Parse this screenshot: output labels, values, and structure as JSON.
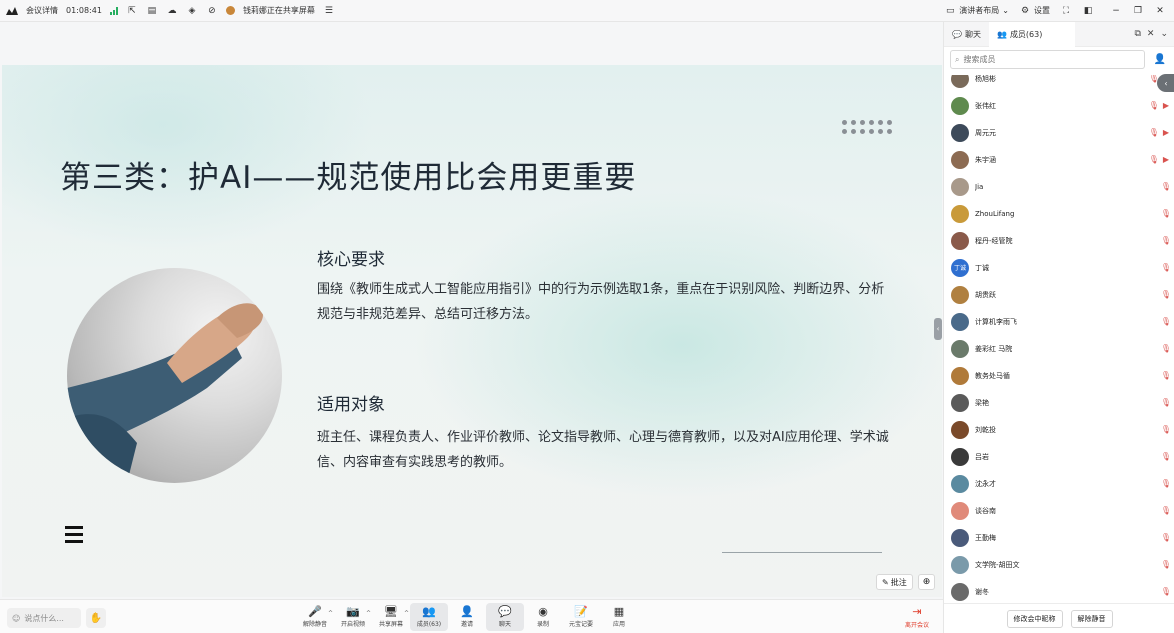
{
  "topbar": {
    "logo_icon": "meeting-logo-icon",
    "meeting_info_label": "会议详情",
    "timer": "01:08:41",
    "sharing_notice": "钱莉娜正在共享屏幕",
    "speaker_layout_label": "演讲者布局",
    "settings_label": "设置"
  },
  "slide": {
    "title": "第三类：护AI——规范使用比会用更重要",
    "section1_title": "核心要求",
    "section1_body": "围绕《教师生成式人工智能应用指引》中的行为示例选取1条，重点在于识别风险、判断边界、分析规范与非规范差异、总结可迁移方法。",
    "section2_title": "适用对象",
    "section2_body": "班主任、课程负责人、作业评价教师、论文指导教师、心理与德育教师，以及对AI应用伦理、学术诚信、内容审查有实践思考的教师。"
  },
  "stage_controls": {
    "annotate_label": "批注"
  },
  "bottombar": {
    "say_placeholder": "说点什么...",
    "tools": [
      {
        "label": "解除静音",
        "icon": "mic-muted-icon",
        "glyph": "🎤",
        "caret": true
      },
      {
        "label": "开启视频",
        "icon": "camera-off-icon",
        "glyph": "📷",
        "caret": true
      },
      {
        "label": "共享屏幕",
        "icon": "share-screen-icon",
        "glyph": "🖥",
        "caret": true
      },
      {
        "label": "成员(63)",
        "icon": "members-icon",
        "glyph": "👥",
        "caret": false,
        "active": true
      },
      {
        "label": "邀请",
        "icon": "invite-icon",
        "glyph": "👤",
        "caret": false
      },
      {
        "label": "聊天",
        "icon": "chat-icon",
        "glyph": "💬",
        "caret": false,
        "active": true
      },
      {
        "label": "录制",
        "icon": "record-icon",
        "glyph": "◉",
        "caret": false
      },
      {
        "label": "元宝记要",
        "icon": "notes-icon",
        "glyph": "📝",
        "caret": false
      },
      {
        "label": "应用",
        "icon": "apps-icon",
        "glyph": "▦",
        "caret": false
      }
    ],
    "leave_label": "离开会议"
  },
  "panel": {
    "chat_tab": "聊天",
    "members_tab": "成员(63)",
    "search_placeholder": "搜索成员",
    "members": [
      {
        "name": "杨旭彬",
        "muted": true,
        "video_off": true,
        "color": "#7a6a5a"
      },
      {
        "name": "张伟红",
        "muted": true,
        "video_off": true,
        "color": "#5f8a4e"
      },
      {
        "name": "周元元",
        "muted": true,
        "video_off": true,
        "color": "#3d4a5a"
      },
      {
        "name": "朱宇涵",
        "muted": true,
        "video_off": true,
        "color": "#8c6b52"
      },
      {
        "name": "Jia",
        "muted": true,
        "video_off": false,
        "color": "#a8998a"
      },
      {
        "name": "ZhouLifang",
        "muted": true,
        "video_off": false,
        "color": "#c99a3a"
      },
      {
        "name": "程丹-经管院",
        "muted": true,
        "video_off": false,
        "color": "#8a5a4a"
      },
      {
        "name": "丁诚",
        "muted": true,
        "video_off": false,
        "color": "#2f6fd0",
        "initials": "丁诚"
      },
      {
        "name": "胡贵跃",
        "muted": true,
        "video_off": false,
        "color": "#b08040"
      },
      {
        "name": "计算机李雨飞",
        "muted": true,
        "video_off": false,
        "color": "#4a6a8a"
      },
      {
        "name": "姜彩红 马院",
        "muted": true,
        "video_off": false,
        "color": "#6a7a6a"
      },
      {
        "name": "教务处马循",
        "muted": true,
        "video_off": false,
        "color": "#b07a3a"
      },
      {
        "name": "梁艳",
        "muted": true,
        "video_off": false,
        "color": "#5a5a5a"
      },
      {
        "name": "刘乾投",
        "muted": true,
        "video_off": false,
        "color": "#7a4a2a"
      },
      {
        "name": "吕岩",
        "muted": true,
        "video_off": false,
        "color": "#3a3a3a"
      },
      {
        "name": "沈永才",
        "muted": true,
        "video_off": false,
        "color": "#5a8aa0"
      },
      {
        "name": "谈谷南",
        "muted": true,
        "video_off": false,
        "color": "#e08a7a"
      },
      {
        "name": "王勤梅",
        "muted": true,
        "video_off": false,
        "color": "#4a5a7a"
      },
      {
        "name": "文学院-胡田文",
        "muted": true,
        "video_off": false,
        "color": "#7a9aaa"
      },
      {
        "name": "谢冬",
        "muted": true,
        "video_off": false,
        "color": "#6a6a6a"
      }
    ],
    "rename_button": "修改会中昵称",
    "unmute_button": "解除静音"
  }
}
